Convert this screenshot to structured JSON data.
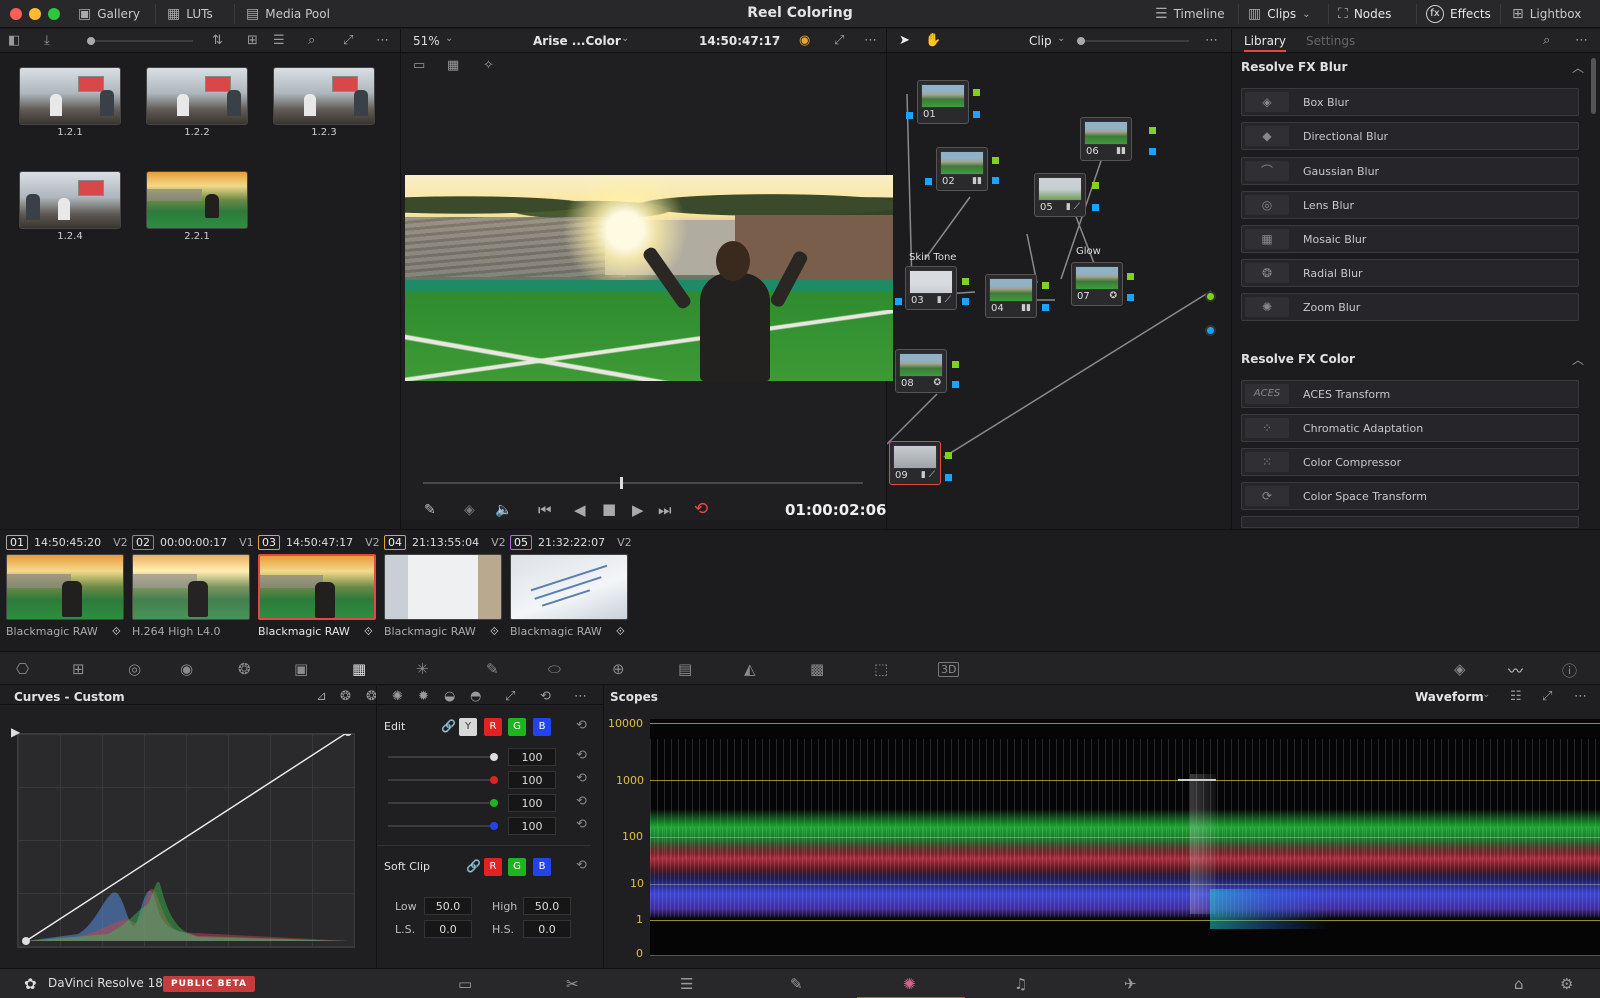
{
  "window": {
    "title": "Reel Coloring"
  },
  "topbar": {
    "gallery": "Gallery",
    "luts": "LUTs",
    "media_pool": "Media Pool",
    "timeline": "Timeline",
    "clips": "Clips",
    "nodes": "Nodes",
    "effects": "Effects",
    "lightbox": "Lightbox"
  },
  "viewer_toolbar": {
    "zoom": "51%",
    "clip_name": "Arise ...Color",
    "timecode": "14:50:47:17",
    "node_mode": "Clip"
  },
  "gallery": {
    "stills": [
      {
        "label": "1.2.1"
      },
      {
        "label": "1.2.2"
      },
      {
        "label": "1.2.3"
      },
      {
        "label": "1.2.4"
      },
      {
        "label": "2.2.1"
      }
    ]
  },
  "transport": {
    "timecode": "01:00:02:06"
  },
  "nodes": {
    "items": [
      {
        "label": "01",
        "title": ""
      },
      {
        "label": "02",
        "title": ""
      },
      {
        "label": "03",
        "title": "Skin Tone"
      },
      {
        "label": "04",
        "title": ""
      },
      {
        "label": "05",
        "title": ""
      },
      {
        "label": "06",
        "title": ""
      },
      {
        "label": "07",
        "title": "Glow"
      },
      {
        "label": "08",
        "title": ""
      },
      {
        "label": "09",
        "title": ""
      }
    ]
  },
  "library": {
    "tab_library": "Library",
    "tab_settings": "Settings",
    "blur_header": "Resolve FX Blur",
    "blur_items": [
      "Box Blur",
      "Directional Blur",
      "Gaussian Blur",
      "Lens Blur",
      "Mosaic Blur",
      "Radial Blur",
      "Zoom Blur"
    ],
    "color_header": "Resolve FX Color",
    "color_items": [
      "ACES Transform",
      "Chromatic Adaptation",
      "Color Compressor",
      "Color Space Transform"
    ],
    "aces_icon_text": "ACES"
  },
  "clips": [
    {
      "num": "01",
      "tc": "14:50:45:20",
      "track": "V2",
      "codec": "Blackmagic RAW"
    },
    {
      "num": "02",
      "tc": "00:00:00:17",
      "track": "V1",
      "codec": "H.264 High L4.0"
    },
    {
      "num": "03",
      "tc": "14:50:47:17",
      "track": "V2",
      "codec": "Blackmagic RAW"
    },
    {
      "num": "04",
      "tc": "21:13:55:04",
      "track": "V2",
      "codec": "Blackmagic RAW"
    },
    {
      "num": "05",
      "tc": "21:32:22:07",
      "track": "V2",
      "codec": "Blackmagic RAW"
    }
  ],
  "curves": {
    "title": "Curves - Custom",
    "edit_label": "Edit",
    "ch_y": "Y",
    "ch_r": "R",
    "ch_g": "G",
    "ch_b": "B",
    "values": [
      "100",
      "100",
      "100",
      "100"
    ],
    "soft_clip": "Soft Clip",
    "low_label": "Low",
    "low": "50.0",
    "high_label": "High",
    "high": "50.0",
    "ls_label": "L.S.",
    "ls": "0.0",
    "hs_label": "H.S.",
    "hs": "0.0"
  },
  "scopes": {
    "title": "Scopes",
    "mode": "Waveform",
    "ticks": [
      "10000",
      "1000",
      "100",
      "10",
      "1",
      "0"
    ]
  },
  "bottombar": {
    "app_name": "DaVinci Resolve 18",
    "badge": "PUBLIC BETA"
  },
  "colors": {
    "accent_red": "#e64646",
    "node_green": "#7ed321",
    "node_blue": "#1aa3ff"
  }
}
